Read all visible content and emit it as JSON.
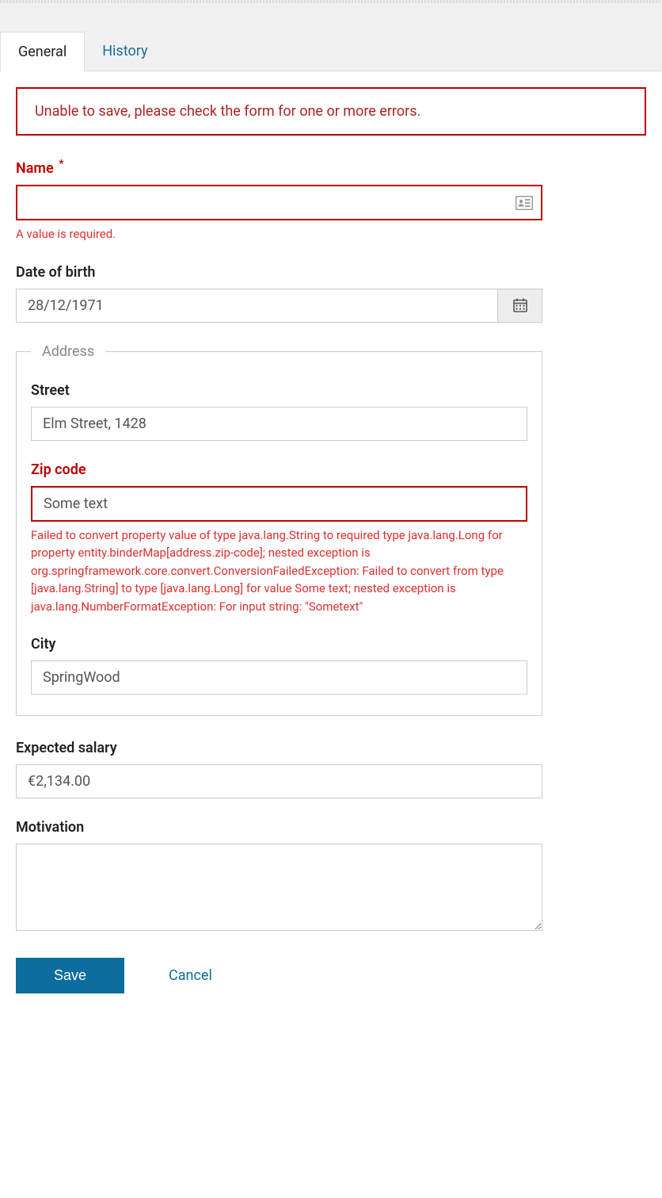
{
  "tabs": {
    "general": "General",
    "history": "History"
  },
  "alert": {
    "message": "Unable to save, please check the form for one or more errors."
  },
  "form": {
    "name": {
      "label": "Name",
      "required_marker": "*",
      "value": "",
      "error": "A value is required."
    },
    "dob": {
      "label": "Date of birth",
      "value": "28/12/1971"
    },
    "address": {
      "legend": "Address",
      "street": {
        "label": "Street",
        "value": "Elm Street, 1428"
      },
      "zip": {
        "label": "Zip code",
        "value": "Some text",
        "error": "Failed to convert property value of type java.lang.String to required type java.lang.Long for property entity.binderMap[address.zip-code]; nested exception is org.springframework.core.convert.ConversionFailedException: Failed to convert from type [java.lang.String] to type [java.lang.Long] for value Some text; nested exception is java.lang.NumberFormatException: For input string: \"Sometext\""
      },
      "city": {
        "label": "City",
        "value": "SpringWood"
      }
    },
    "salary": {
      "label": "Expected salary",
      "value": "€2,134.00"
    },
    "motivation": {
      "label": "Motivation",
      "value": ""
    }
  },
  "actions": {
    "save": "Save",
    "cancel": "Cancel"
  }
}
